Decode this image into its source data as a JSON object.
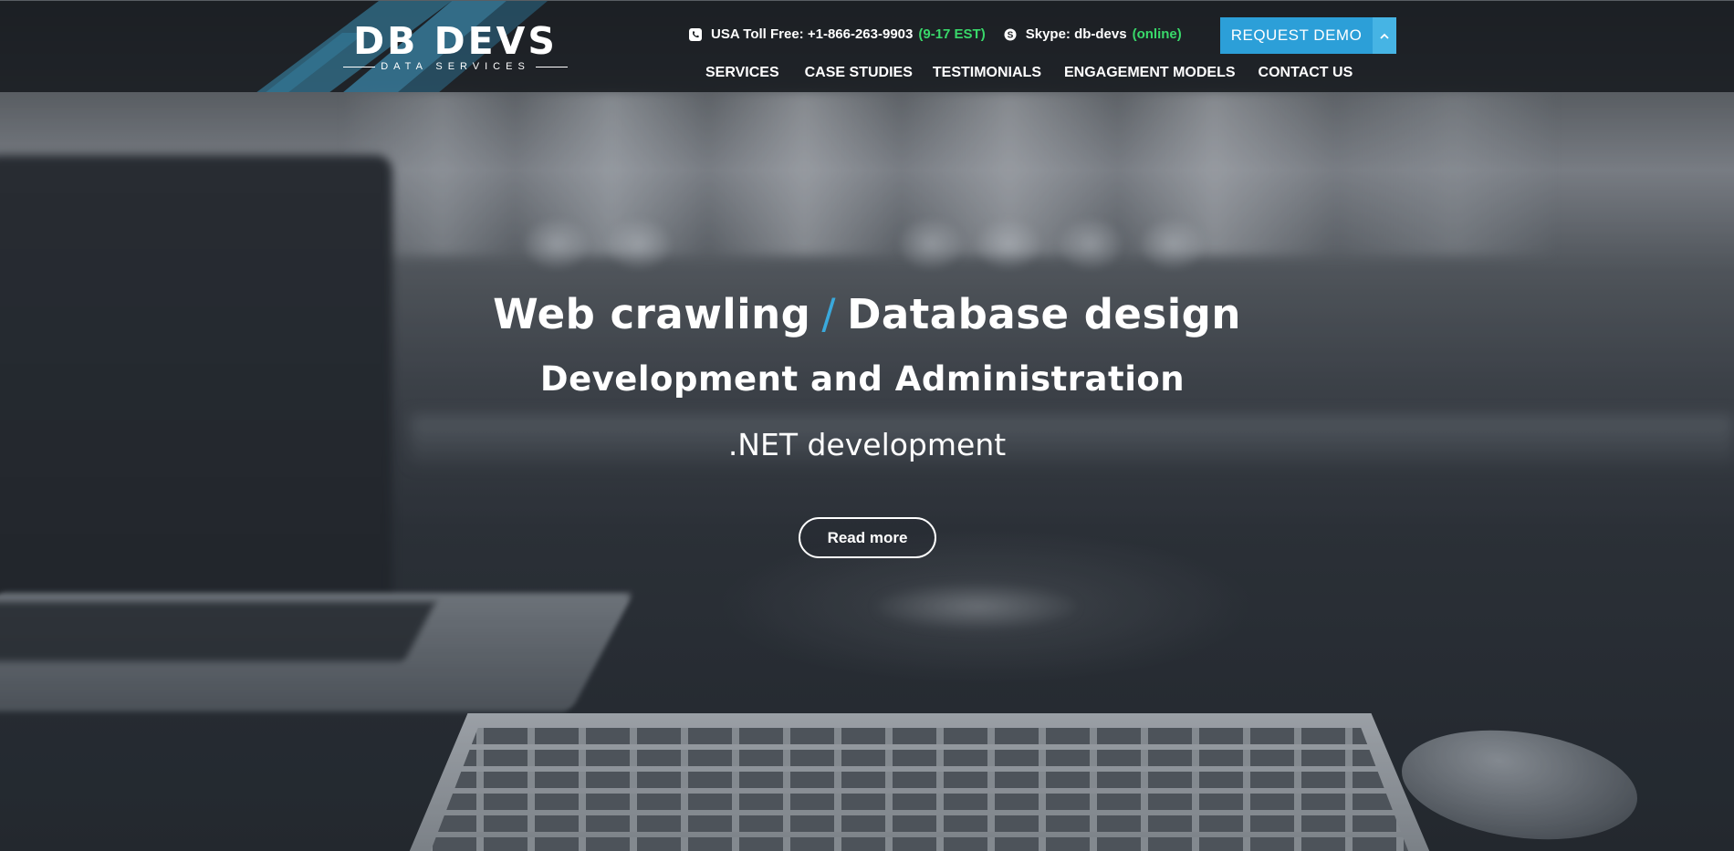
{
  "brand": {
    "name": "DB DEVS",
    "tagline": "DATA SERVICES",
    "accent_color": "#2c9fd8"
  },
  "contact": {
    "phone_icon": "phone-icon",
    "phone_label": "USA Toll Free: +1-866-263-9903",
    "phone_hours": "(9-17 EST)",
    "skype_icon": "skype-icon",
    "skype_label": "Skype: db-devs",
    "skype_status": "(online)",
    "status_color": "#39d86a"
  },
  "request_demo": {
    "label": "REQUEST DEMO",
    "icon": "chevron-up-icon"
  },
  "nav": {
    "items": [
      {
        "label": "SERVICES"
      },
      {
        "label": "CASE STUDIES"
      },
      {
        "label": "TESTIMONIALS"
      },
      {
        "label": "ENGAGEMENT MODELS"
      },
      {
        "label": "CONTACT US"
      }
    ]
  },
  "hero": {
    "headline_left": "Web crawling",
    "headline_separator": "/",
    "headline_right": "Database design",
    "subline": "Development and Administration",
    "tertiary": ".NET development",
    "cta_label": "Read more"
  }
}
